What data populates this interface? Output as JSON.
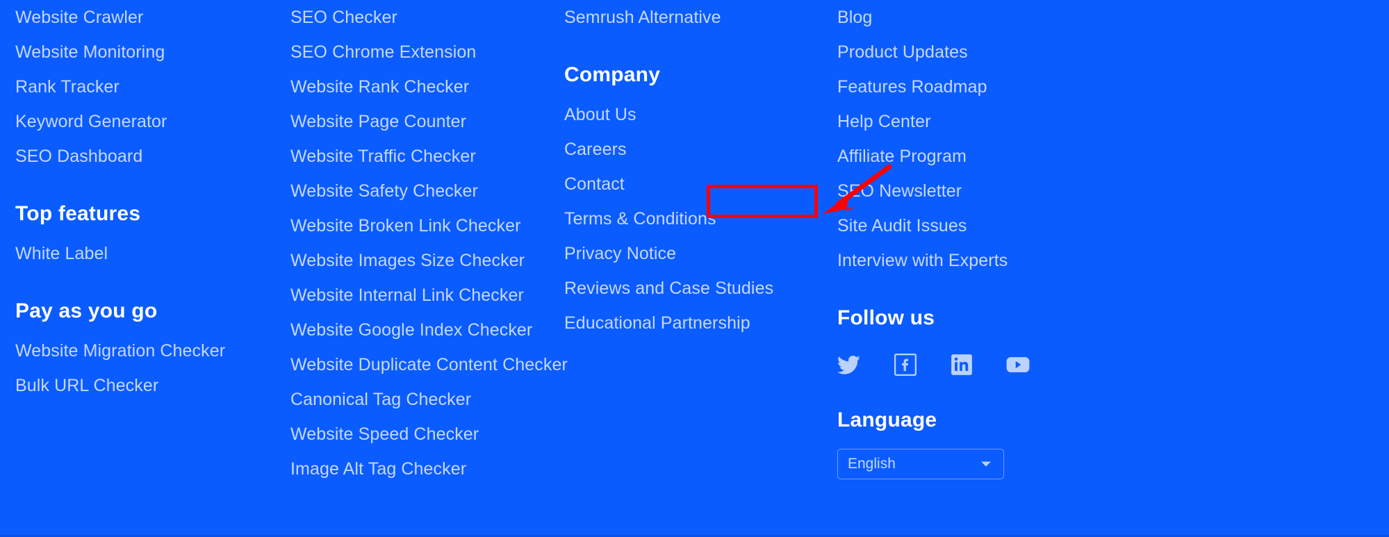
{
  "theme": {
    "background": "#0B5CFF",
    "link_color": "#C5D8FF",
    "heading_color": "#FFFFFF",
    "annotation_color": "#FF0000"
  },
  "columns": [
    {
      "name": "products-column",
      "blocks": [
        {
          "type": "links",
          "items": [
            "Website Crawler",
            "Website Monitoring",
            "Rank Tracker",
            "Keyword Generator",
            "SEO Dashboard"
          ]
        },
        {
          "type": "section",
          "heading": "Top features",
          "items": [
            "White Label"
          ]
        },
        {
          "type": "section",
          "heading": "Pay as you go",
          "items": [
            "Website Migration Checker",
            "Bulk URL Checker"
          ]
        }
      ]
    },
    {
      "name": "tools-column",
      "blocks": [
        {
          "type": "links",
          "items": [
            "SEO Checker",
            "SEO Chrome Extension",
            "Website Rank Checker",
            "Website Page Counter",
            "Website Traffic Checker",
            "Website Safety Checker",
            "Website Broken Link Checker",
            "Website Images Size Checker",
            "Website Internal Link Checker",
            "Website Google Index Checker",
            "Website Duplicate Content Checker",
            "Canonical Tag Checker",
            "Website Speed Checker",
            "Image Alt Tag Checker"
          ]
        }
      ]
    },
    {
      "name": "company-column",
      "blocks": [
        {
          "type": "links",
          "items": [
            "Semrush Alternative"
          ]
        },
        {
          "type": "section",
          "heading": "Company",
          "items": [
            "About Us",
            "Careers",
            "Contact",
            "Terms & Conditions",
            "Privacy Notice",
            "Reviews and Case Studies",
            "Educational Partnership"
          ]
        }
      ]
    },
    {
      "name": "resources-column",
      "blocks": [
        {
          "type": "links",
          "items": [
            "Blog",
            "Product Updates",
            "Features Roadmap",
            "Help Center",
            "Affiliate Program",
            "SEO Newsletter",
            "Site Audit Issues",
            "Interview with Experts"
          ]
        },
        {
          "type": "social",
          "heading": "Follow us",
          "icons": [
            {
              "name": "twitter-icon",
              "label": "Twitter"
            },
            {
              "name": "facebook-icon",
              "label": "Facebook"
            },
            {
              "name": "linkedin-icon",
              "label": "LinkedIn"
            },
            {
              "name": "youtube-icon",
              "label": "YouTube"
            }
          ]
        },
        {
          "type": "language",
          "heading": "Language",
          "selected": "English"
        }
      ]
    }
  ],
  "annotation": {
    "target_label": "Contact",
    "box_color": "#FF0000",
    "arrow_color": "#FF0000"
  }
}
